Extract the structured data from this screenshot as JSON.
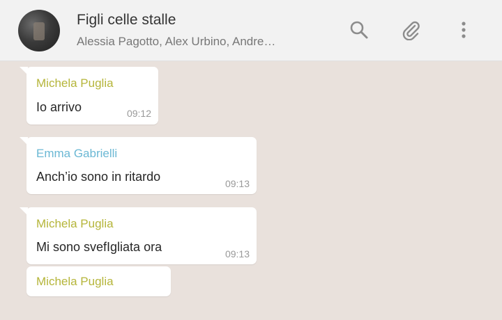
{
  "header": {
    "title": "Figli celle stalle",
    "participants": "Alessia Pagotto, Alex Urbino, Andre…",
    "icons": [
      "search-icon",
      "paperclip-icon",
      "menu-icon"
    ]
  },
  "colors": {
    "chat_background": "#e9e1dc",
    "header_background": "#f2f2f2",
    "sender_michela": "#b5b53a",
    "sender_emma": "#6bb8d4"
  },
  "messages": [
    {
      "sender": "Michela Puglia",
      "text": "Io arrivo",
      "time": "09:12"
    },
    {
      "sender": "Emma Gabrielli",
      "text": "Anch’io sono in ritardo",
      "time": "09:13"
    },
    {
      "sender": "Michela Puglia",
      "text": "Mi sono svefIgliata ora",
      "time": "09:13"
    },
    {
      "sender": "Michela Puglia",
      "text": "",
      "time": ""
    }
  ]
}
